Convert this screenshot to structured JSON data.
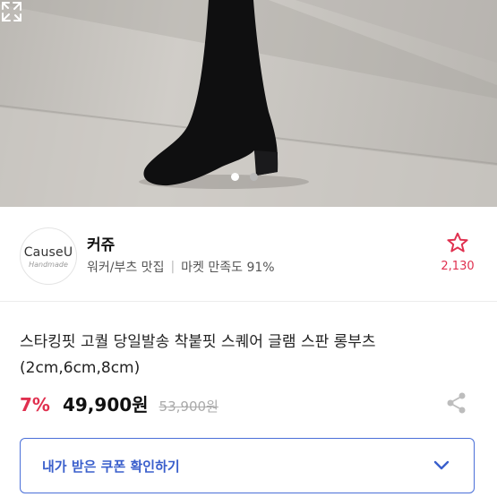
{
  "hero": {
    "slide_count": 2,
    "active_slide": 1,
    "background_color": "#c8c5c0",
    "boot_color": "#0f0f10",
    "expand_icon": "expand-icon"
  },
  "shop": {
    "logo_main": "CauseU",
    "logo_sub": "Handmade",
    "name": "커쥬",
    "category": "워커/부츠 맛집",
    "satisfaction": "마켓 만족도 91%",
    "favorite_icon": "star-outline-icon",
    "favorite_count": "2,130"
  },
  "product": {
    "title": "스타킹핏 고퀄 당일발송 착붙핏 스퀘어 글램 스판 롱부츠 (2cm,6cm,8cm)",
    "discount": "7%",
    "price": "49,900원",
    "original_price": "53,900원",
    "share_icon": "share-icon"
  },
  "coupon": {
    "label": "내가 받은 쿠폰 확인하기",
    "icon": "chevron-down-icon"
  },
  "colors": {
    "accent_red": "#e0304f",
    "accent_blue": "#3a5fcc",
    "coupon_border": "#4a6fd8"
  }
}
